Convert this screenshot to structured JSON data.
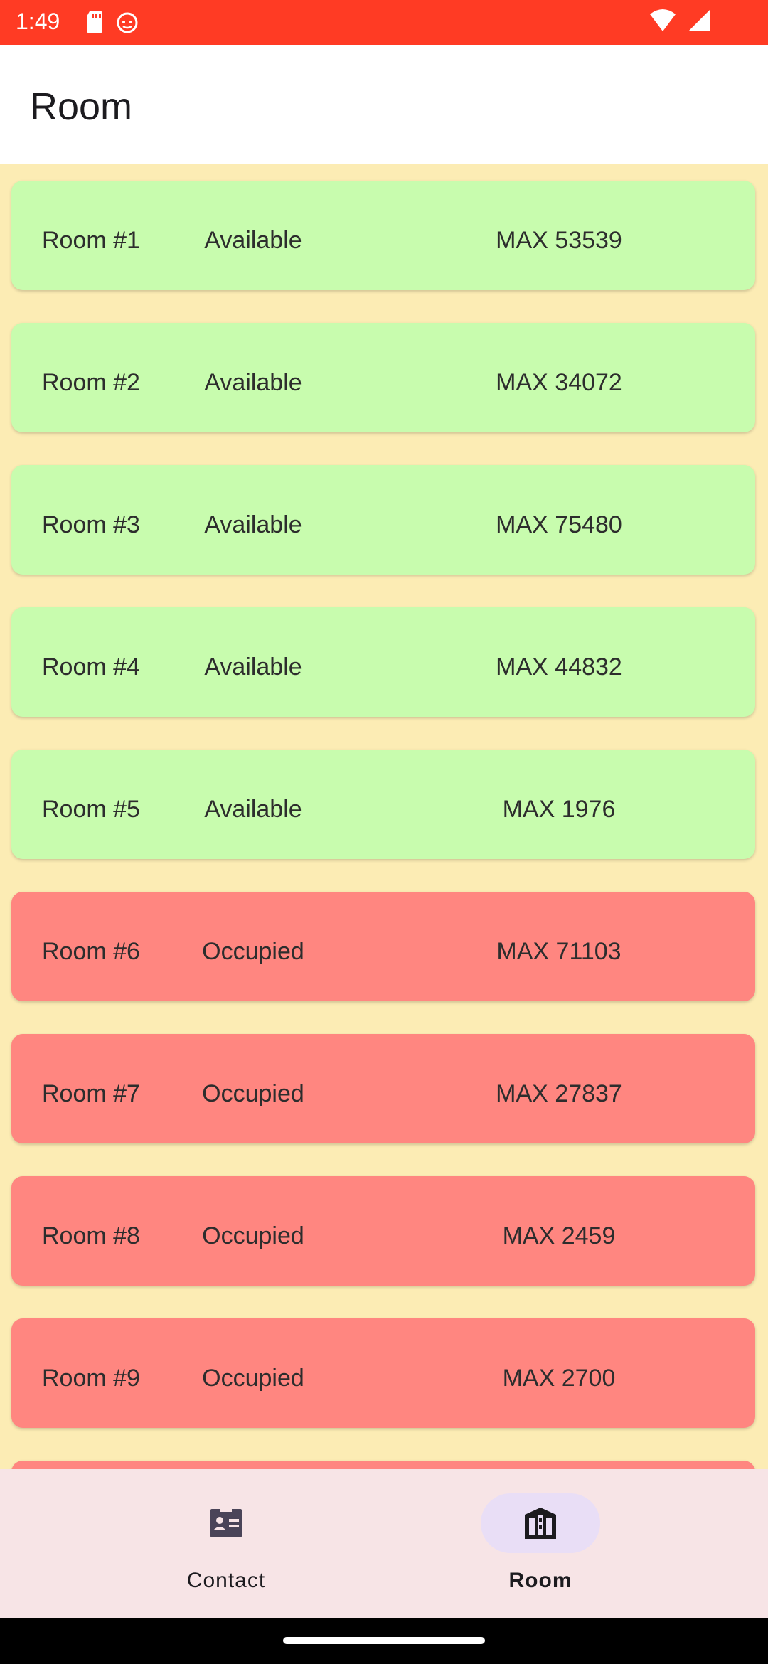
{
  "status_bar": {
    "time": "1:49",
    "icons": [
      "sd-card-icon",
      "notification-app-icon",
      "wifi-icon",
      "cell-signal-icon"
    ]
  },
  "app_bar": {
    "title": "Room"
  },
  "rooms": [
    {
      "name": "Room #1",
      "status": "Available",
      "max": "MAX 53539"
    },
    {
      "name": "Room #2",
      "status": "Available",
      "max": "MAX 34072"
    },
    {
      "name": "Room #3",
      "status": "Available",
      "max": "MAX 75480"
    },
    {
      "name": "Room #4",
      "status": "Available",
      "max": "MAX 44832"
    },
    {
      "name": "Room #5",
      "status": "Available",
      "max": "MAX 1976"
    },
    {
      "name": "Room #6",
      "status": "Occupied",
      "max": "MAX 71103"
    },
    {
      "name": "Room #7",
      "status": "Occupied",
      "max": "MAX 27837"
    },
    {
      "name": "Room #8",
      "status": "Occupied",
      "max": "MAX 2459"
    },
    {
      "name": "Room #9",
      "status": "Occupied",
      "max": "MAX 2700"
    }
  ],
  "bottom_nav": {
    "items": [
      {
        "label": "Contact",
        "icon": "contact-card-icon",
        "selected": false
      },
      {
        "label": "Room",
        "icon": "building-icon",
        "selected": true
      }
    ]
  },
  "colors": {
    "status_bar": "#FF3B24",
    "background": "#FCECB4",
    "available": "#C8FCAE",
    "occupied": "#FF8680",
    "nav_background": "#F7E4E6",
    "nav_active_pill": "#E9DEF6"
  }
}
